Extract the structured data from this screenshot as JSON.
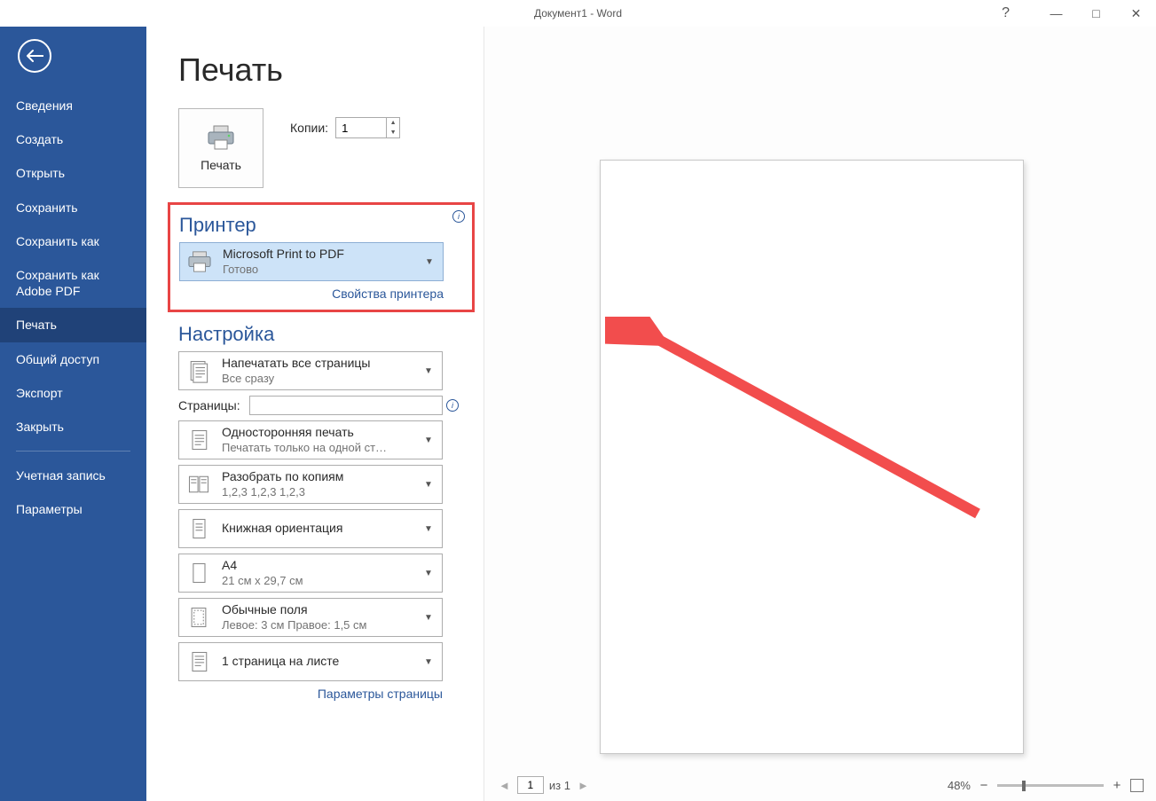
{
  "window": {
    "title": "Документ1 - Word"
  },
  "sidebar": {
    "items": [
      {
        "label": "Сведения"
      },
      {
        "label": "Создать"
      },
      {
        "label": "Открыть"
      },
      {
        "label": "Сохранить"
      },
      {
        "label": "Сохранить как"
      },
      {
        "label": "Сохранить как Adobe PDF"
      },
      {
        "label": "Печать"
      },
      {
        "label": "Общий доступ"
      },
      {
        "label": "Экспорт"
      },
      {
        "label": "Закрыть"
      }
    ],
    "footer": [
      {
        "label": "Учетная запись"
      },
      {
        "label": "Параметры"
      }
    ],
    "active_index": 6
  },
  "page": {
    "heading": "Печать",
    "print_button": "Печать",
    "copies_label": "Копии:",
    "copies_value": "1",
    "printer_section": "Принтер",
    "printer": {
      "name": "Microsoft Print to PDF",
      "status": "Готово"
    },
    "printer_properties": "Свойства принтера",
    "settings_section": "Настройка",
    "setting_pages": {
      "title": "Напечатать все страницы",
      "sub": "Все сразу"
    },
    "pages_label": "Страницы:",
    "pages_value": "",
    "setting_sides": {
      "title": "Односторонняя печать",
      "sub": "Печатать только на одной ст…"
    },
    "setting_collate": {
      "title": "Разобрать по копиям",
      "sub": "1,2,3    1,2,3    1,2,3"
    },
    "setting_orientation": {
      "title": "Книжная ориентация",
      "sub": ""
    },
    "setting_paper": {
      "title": "A4",
      "sub": "21 см x 29,7 см"
    },
    "setting_margins": {
      "title": "Обычные поля",
      "sub": "Левое: 3 см   Правое: 1,5 см"
    },
    "setting_ppsheet": {
      "title": "1 страница на листе",
      "sub": ""
    },
    "page_setup": "Параметры страницы"
  },
  "preview": {
    "page_current": "1",
    "page_of": "из 1",
    "zoom": "48%"
  }
}
